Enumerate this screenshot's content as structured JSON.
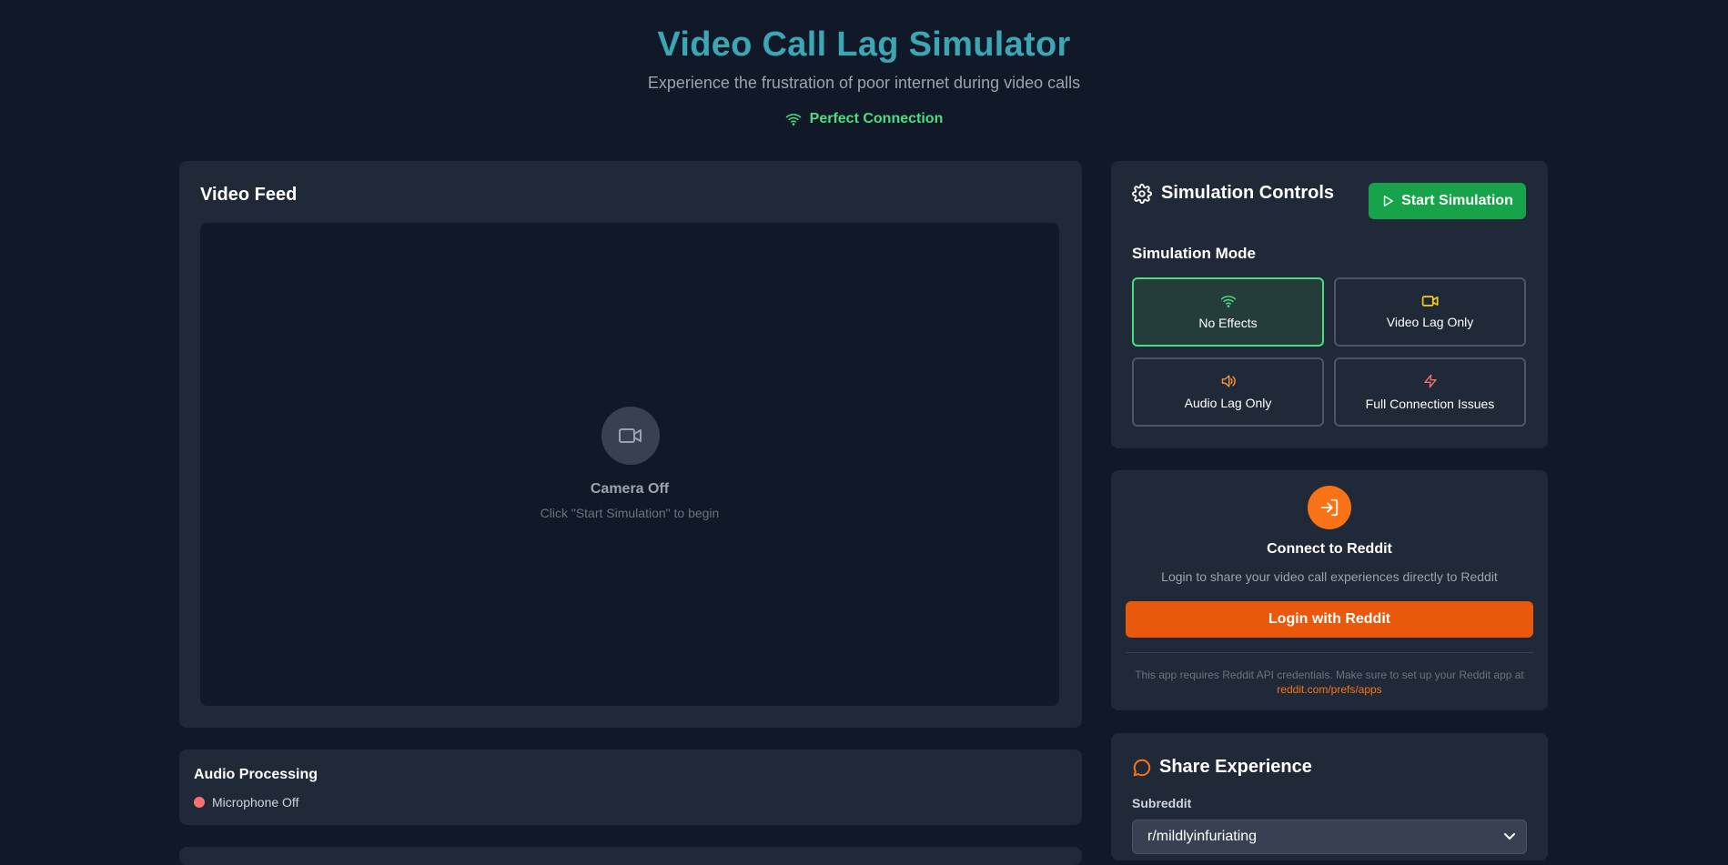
{
  "header": {
    "title": "Video Call Lag Simulator",
    "subtitle": "Experience the frustration of poor internet during video calls",
    "status": "Perfect Connection"
  },
  "video": {
    "heading": "Video Feed",
    "camera_status": "Camera Off",
    "hint": "Click \"Start Simulation\" to begin"
  },
  "audio": {
    "heading": "Audio Processing",
    "mic_status": "Microphone Off"
  },
  "controls": {
    "heading": "Simulation Controls",
    "start_label": "Start Simulation",
    "mode_heading": "Simulation Mode",
    "modes": [
      {
        "label": "No Effects",
        "icon": "wifi-icon",
        "color": "#4ade80",
        "active": true
      },
      {
        "label": "Video Lag Only",
        "icon": "video-icon",
        "color": "#facc15",
        "active": false
      },
      {
        "label": "Audio Lag Only",
        "icon": "speaker-icon",
        "color": "#fb923c",
        "active": false
      },
      {
        "label": "Full Connection Issues",
        "icon": "zap-icon",
        "color": "#f87171",
        "active": false
      }
    ]
  },
  "reddit": {
    "heading": "Connect to Reddit",
    "description": "Login to share your video call experiences directly to Reddit",
    "login_label": "Login with Reddit",
    "note": "This app requires Reddit API credentials. Make sure to set up your Reddit app at",
    "note_link": "reddit.com/prefs/apps"
  },
  "share": {
    "heading": "Share Experience",
    "subreddit_label": "Subreddit",
    "subreddit_value": "r/mildlyinfuriating"
  },
  "colors": {
    "background": "#111827",
    "panel": "#1f2937",
    "title": "#3ba6b4",
    "success": "#4ade80",
    "primary_button": "#16a34a",
    "reddit_orange": "#ea580c"
  }
}
